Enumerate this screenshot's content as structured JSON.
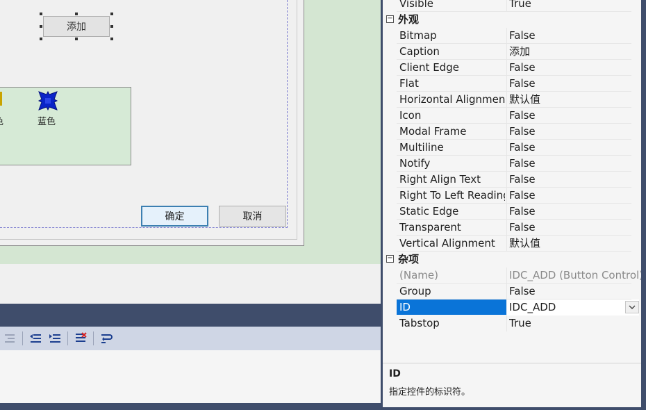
{
  "dialog": {
    "add_button_label": "添加",
    "blue_label": "蓝色",
    "partial_label": "色",
    "ok_label": "确定",
    "cancel_label": "取消"
  },
  "toolbar": {
    "icons": [
      "outdent-icon",
      "indent-decrease-icon",
      "indent-increase-icon",
      "comment-lines-icon",
      "word-wrap-icon"
    ]
  },
  "properties": {
    "top_row": {
      "name": "Visible",
      "value": "True"
    },
    "appearance_category": "外观",
    "appearance": [
      {
        "name": "Bitmap",
        "value": "False"
      },
      {
        "name": "Caption",
        "value": "添加"
      },
      {
        "name": "Client Edge",
        "value": "False"
      },
      {
        "name": "Flat",
        "value": "False"
      },
      {
        "name": "Horizontal Alignment",
        "value": "默认值"
      },
      {
        "name": "Icon",
        "value": "False"
      },
      {
        "name": "Modal Frame",
        "value": "False"
      },
      {
        "name": "Multiline",
        "value": "False"
      },
      {
        "name": "Notify",
        "value": "False"
      },
      {
        "name": "Right Align Text",
        "value": "False"
      },
      {
        "name": "Right To Left Reading",
        "value": "False"
      },
      {
        "name": "Static Edge",
        "value": "False"
      },
      {
        "name": "Transparent",
        "value": "False"
      },
      {
        "name": "Vertical Alignment",
        "value": "默认值"
      }
    ],
    "misc_category": "杂项",
    "misc": [
      {
        "name": "(Name)",
        "value": "IDC_ADD (Button Control)"
      },
      {
        "name": "Group",
        "value": "False"
      },
      {
        "name": "ID",
        "value": "IDC_ADD"
      },
      {
        "name": "Tabstop",
        "value": "True"
      }
    ],
    "description_title": "ID",
    "description_text": "指定控件的标识符。"
  },
  "colors": {
    "selection": "#0a74d8",
    "canvas_green": "#d4e6d2",
    "ide_frame": "#3f4d6b"
  }
}
